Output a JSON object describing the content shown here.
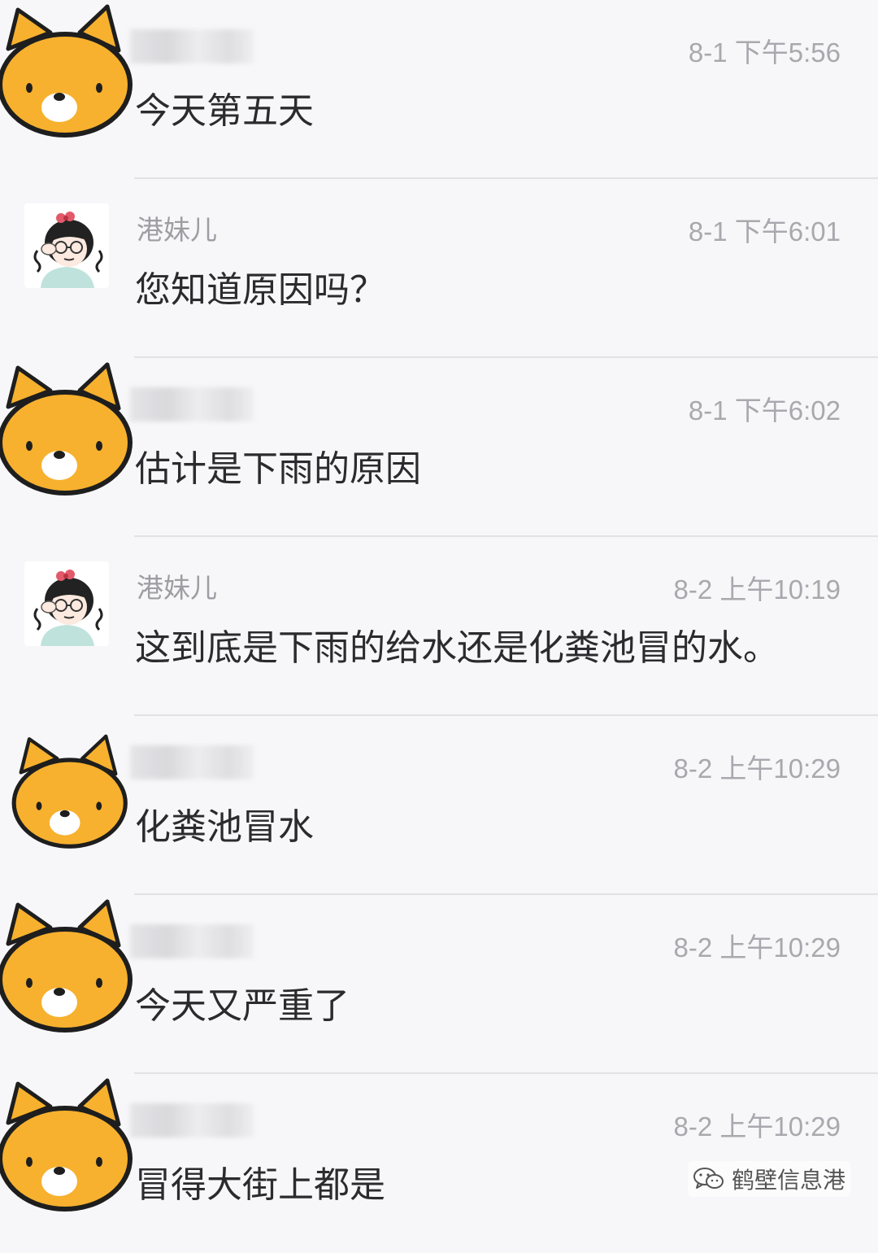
{
  "colors": {
    "bear_fill": "#F7B12E",
    "bear_outline": "#1E1E1E",
    "background": "#F7F7F9",
    "divider": "#E2E2E6"
  },
  "messages": [
    {
      "avatar": "bear-avatar",
      "name": "",
      "time": "8-1 下午5:56",
      "text": "今天第五天"
    },
    {
      "avatar": "girl-avatar",
      "name": "港妹儿",
      "time": "8-1 下午6:01",
      "text": "您知道原因吗？"
    },
    {
      "avatar": "bear-avatar",
      "name": "",
      "time": "8-1 下午6:02",
      "text": "估计是下雨的原因"
    },
    {
      "avatar": "girl-avatar",
      "name": "港妹儿",
      "time": "8-2 上午10:19",
      "text": "这到底是下雨的给水还是化粪池冒的水。"
    },
    {
      "avatar": "bear-avatar",
      "name": "",
      "time": "8-2 上午10:29",
      "text": "化粪池冒水"
    },
    {
      "avatar": "bear-avatar",
      "name": "",
      "time": "8-2 上午10:29",
      "text": "今天又严重了"
    },
    {
      "avatar": "bear-avatar",
      "name": "",
      "time": "8-2 上午10:29",
      "text": "冒得大街上都是"
    }
  ],
  "watermark": {
    "icon": "wechat-icon",
    "text": "鹤壁信息港"
  }
}
